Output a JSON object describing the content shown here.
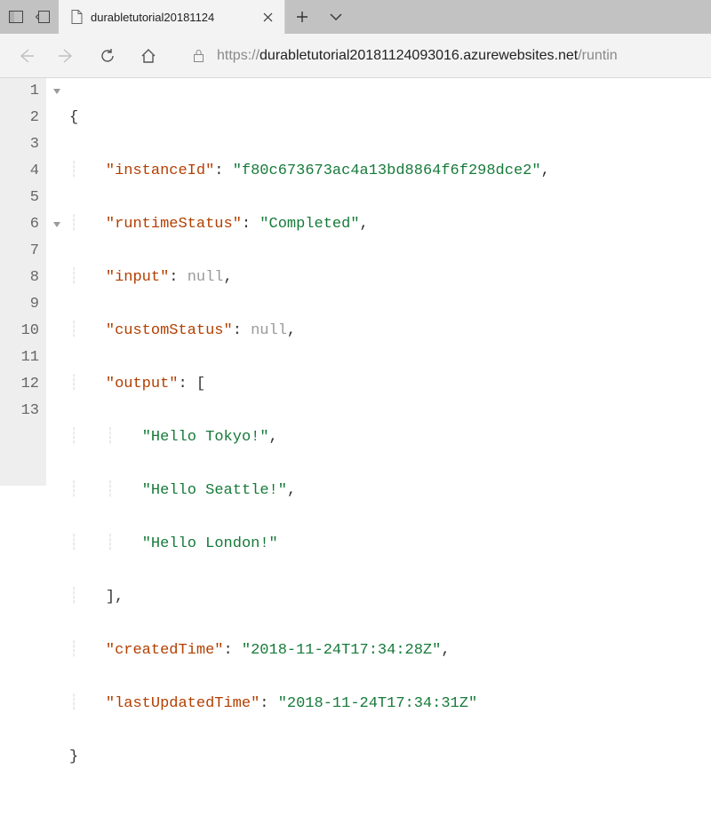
{
  "tab": {
    "title": "durabletutorial20181124"
  },
  "address": {
    "protocol": "https://",
    "host": "durabletutorial20181124093016.azurewebsites.net",
    "rest": "/runtin"
  },
  "json_view": {
    "keys": {
      "instanceId": "instanceId",
      "runtimeStatus": "runtimeStatus",
      "input": "input",
      "customStatus": "customStatus",
      "output": "output",
      "createdTime": "createdTime",
      "lastUpdatedTime": "lastUpdatedTime"
    },
    "values": {
      "instanceId": "f80c673673ac4a13bd8864f6f298dce2",
      "runtimeStatus": "Completed",
      "input": "null",
      "customStatus": "null",
      "output_0": "Hello Tokyo!",
      "output_1": "Hello Seattle!",
      "output_2": "Hello London!",
      "createdTime": "2018-11-24T17:34:28Z",
      "lastUpdatedTime": "2018-11-24T17:34:31Z"
    },
    "line_numbers": [
      "1",
      "2",
      "3",
      "4",
      "5",
      "6",
      "7",
      "8",
      "9",
      "10",
      "11",
      "12",
      "13"
    ]
  }
}
